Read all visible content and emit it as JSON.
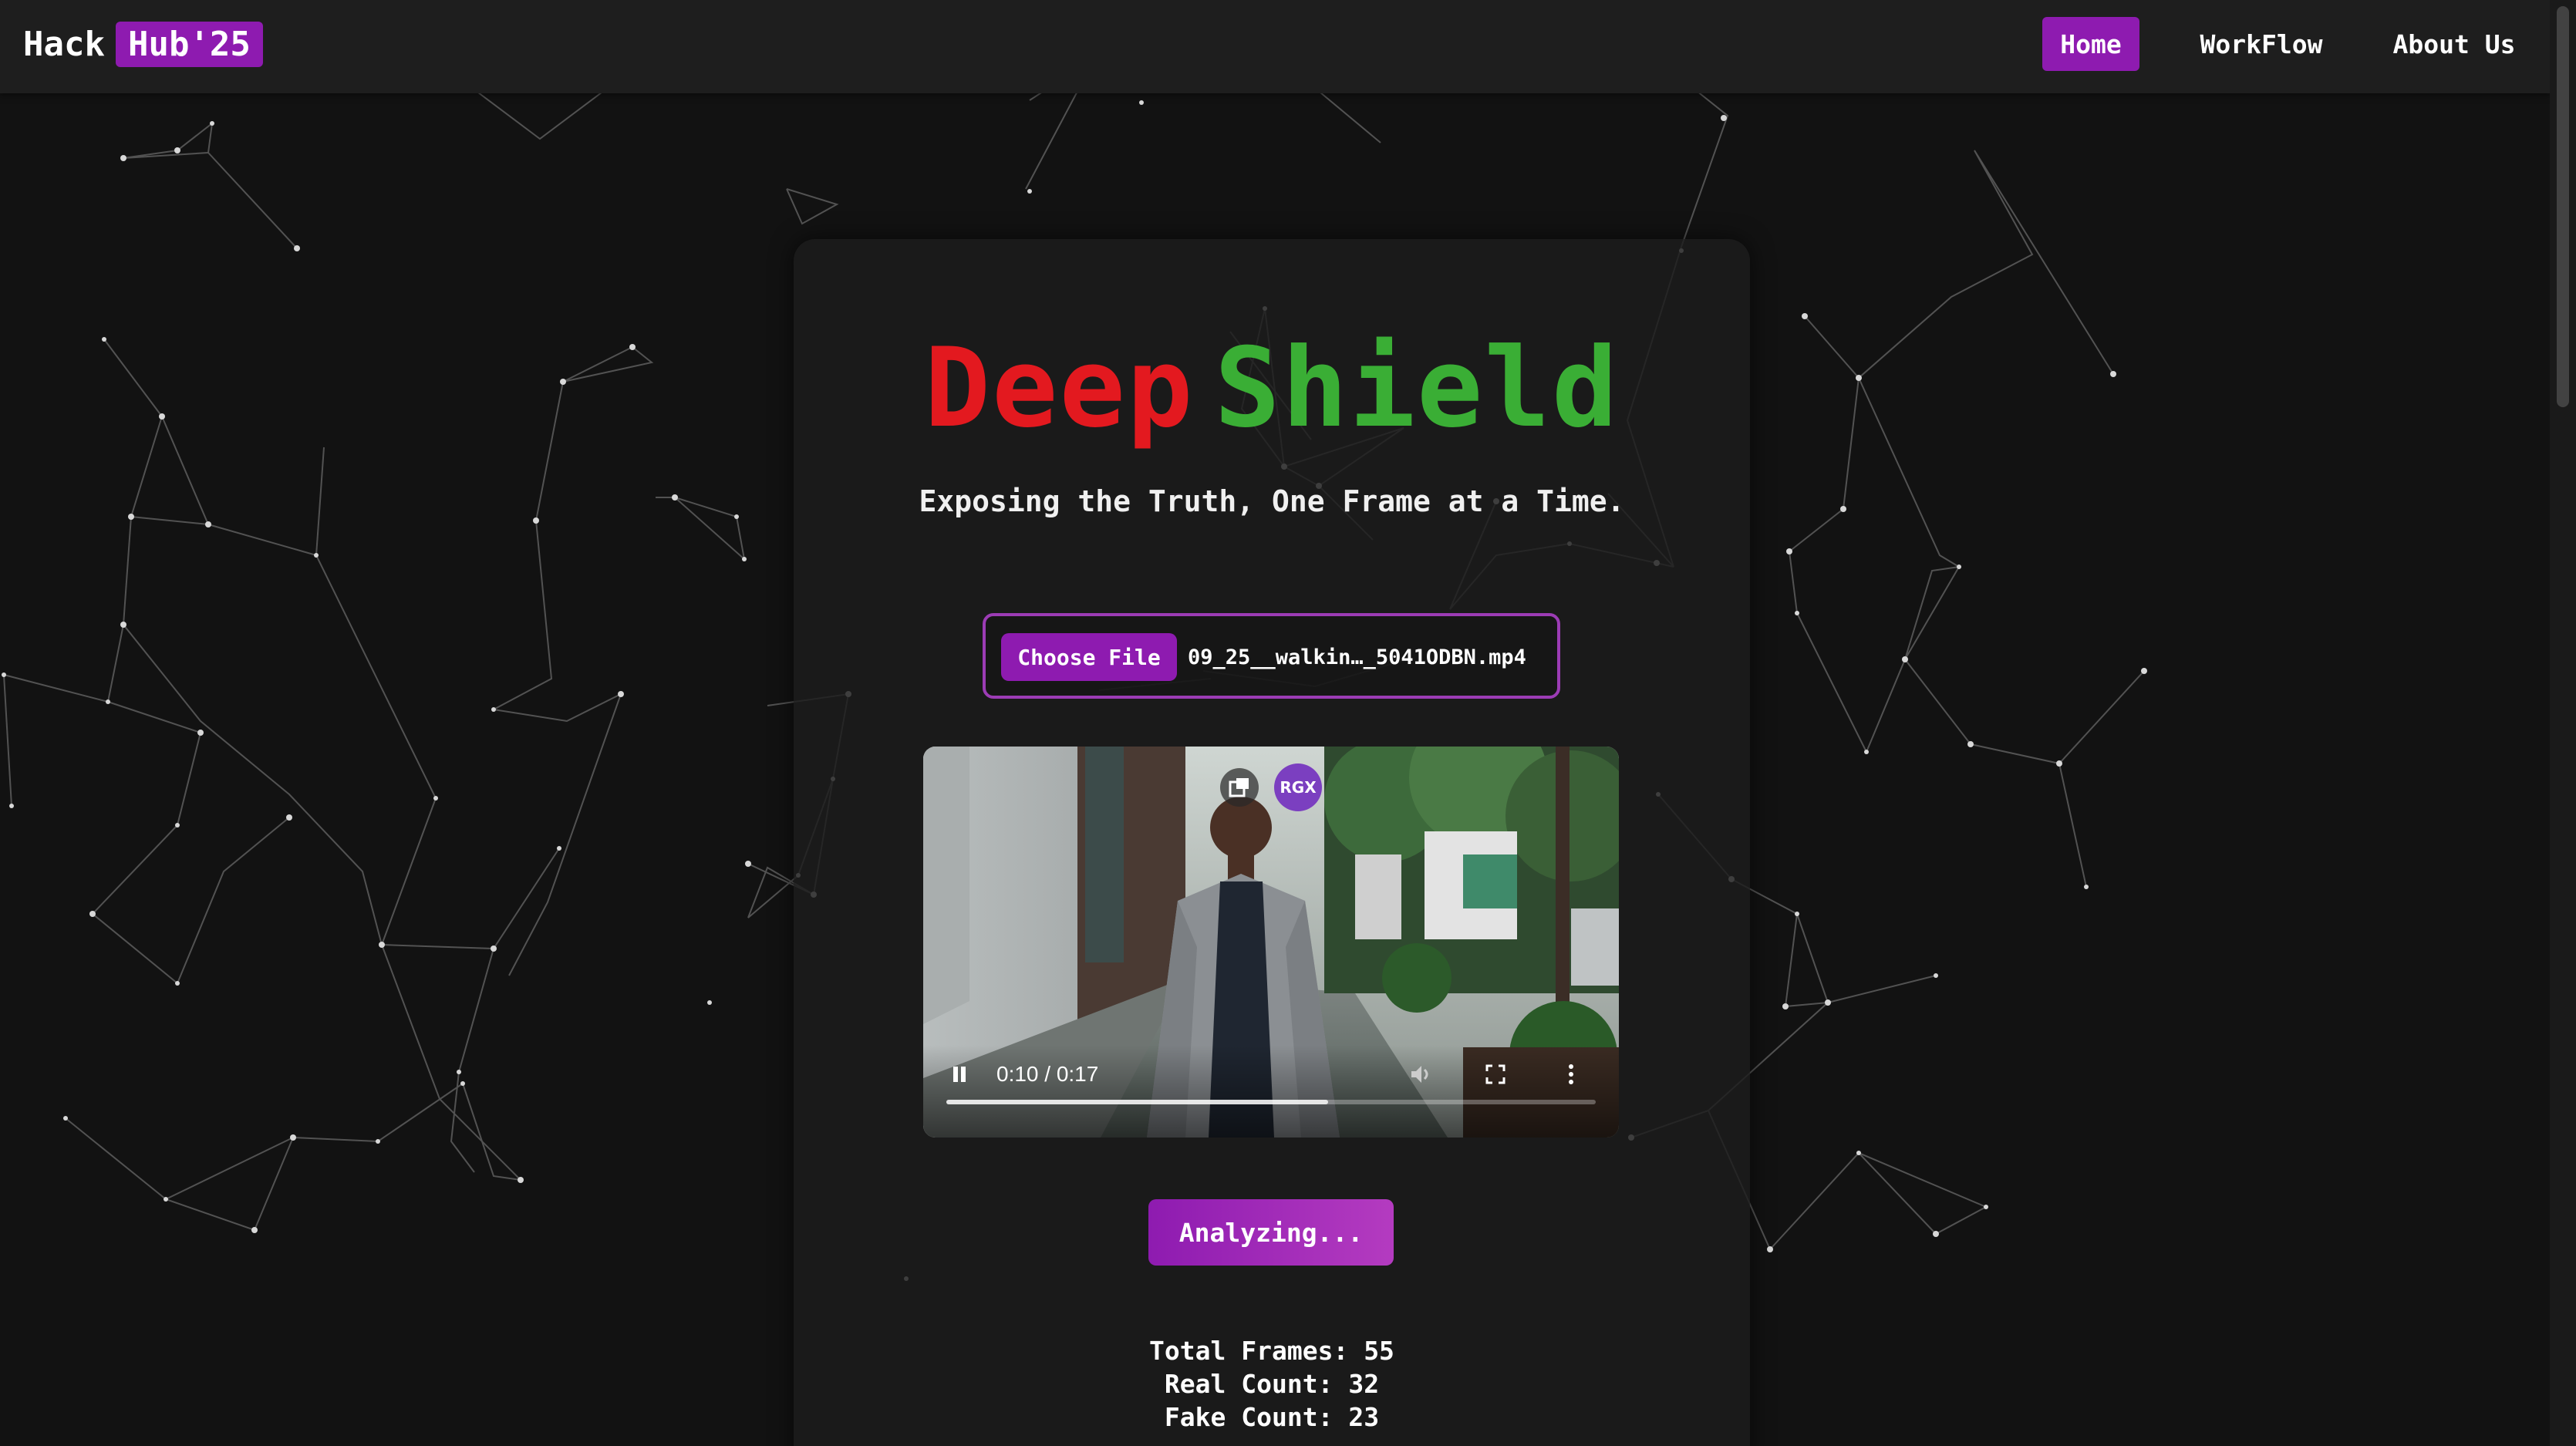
{
  "navbar": {
    "brand_hack": "Hack",
    "brand_hub": "Hub'25",
    "links": [
      {
        "label": "Home",
        "active": true
      },
      {
        "label": "WorkFlow",
        "active": false
      },
      {
        "label": "About Us",
        "active": false
      }
    ]
  },
  "hero": {
    "title_part1": "Deep",
    "title_part2": "Shield",
    "subtitle": "Exposing the Truth, One Frame at a Time."
  },
  "upload": {
    "button_label": "Choose File",
    "file_name": "09_25__walkin…_5041ODBN.mp4"
  },
  "video": {
    "time": "0:10 / 0:17",
    "progress_fraction": 0.588,
    "overlay_badge": "RGX",
    "playing": true
  },
  "analyze": {
    "label": "Analyzing..."
  },
  "stats": {
    "total_frames": "Total Frames: 55",
    "real_count": "Real Count: 32",
    "fake_count": "Fake Count: 23"
  },
  "colors": {
    "accent": "#8e1bb0",
    "deep_red": "#e3191f",
    "shield_green": "#3aae35",
    "background": "#121212"
  }
}
